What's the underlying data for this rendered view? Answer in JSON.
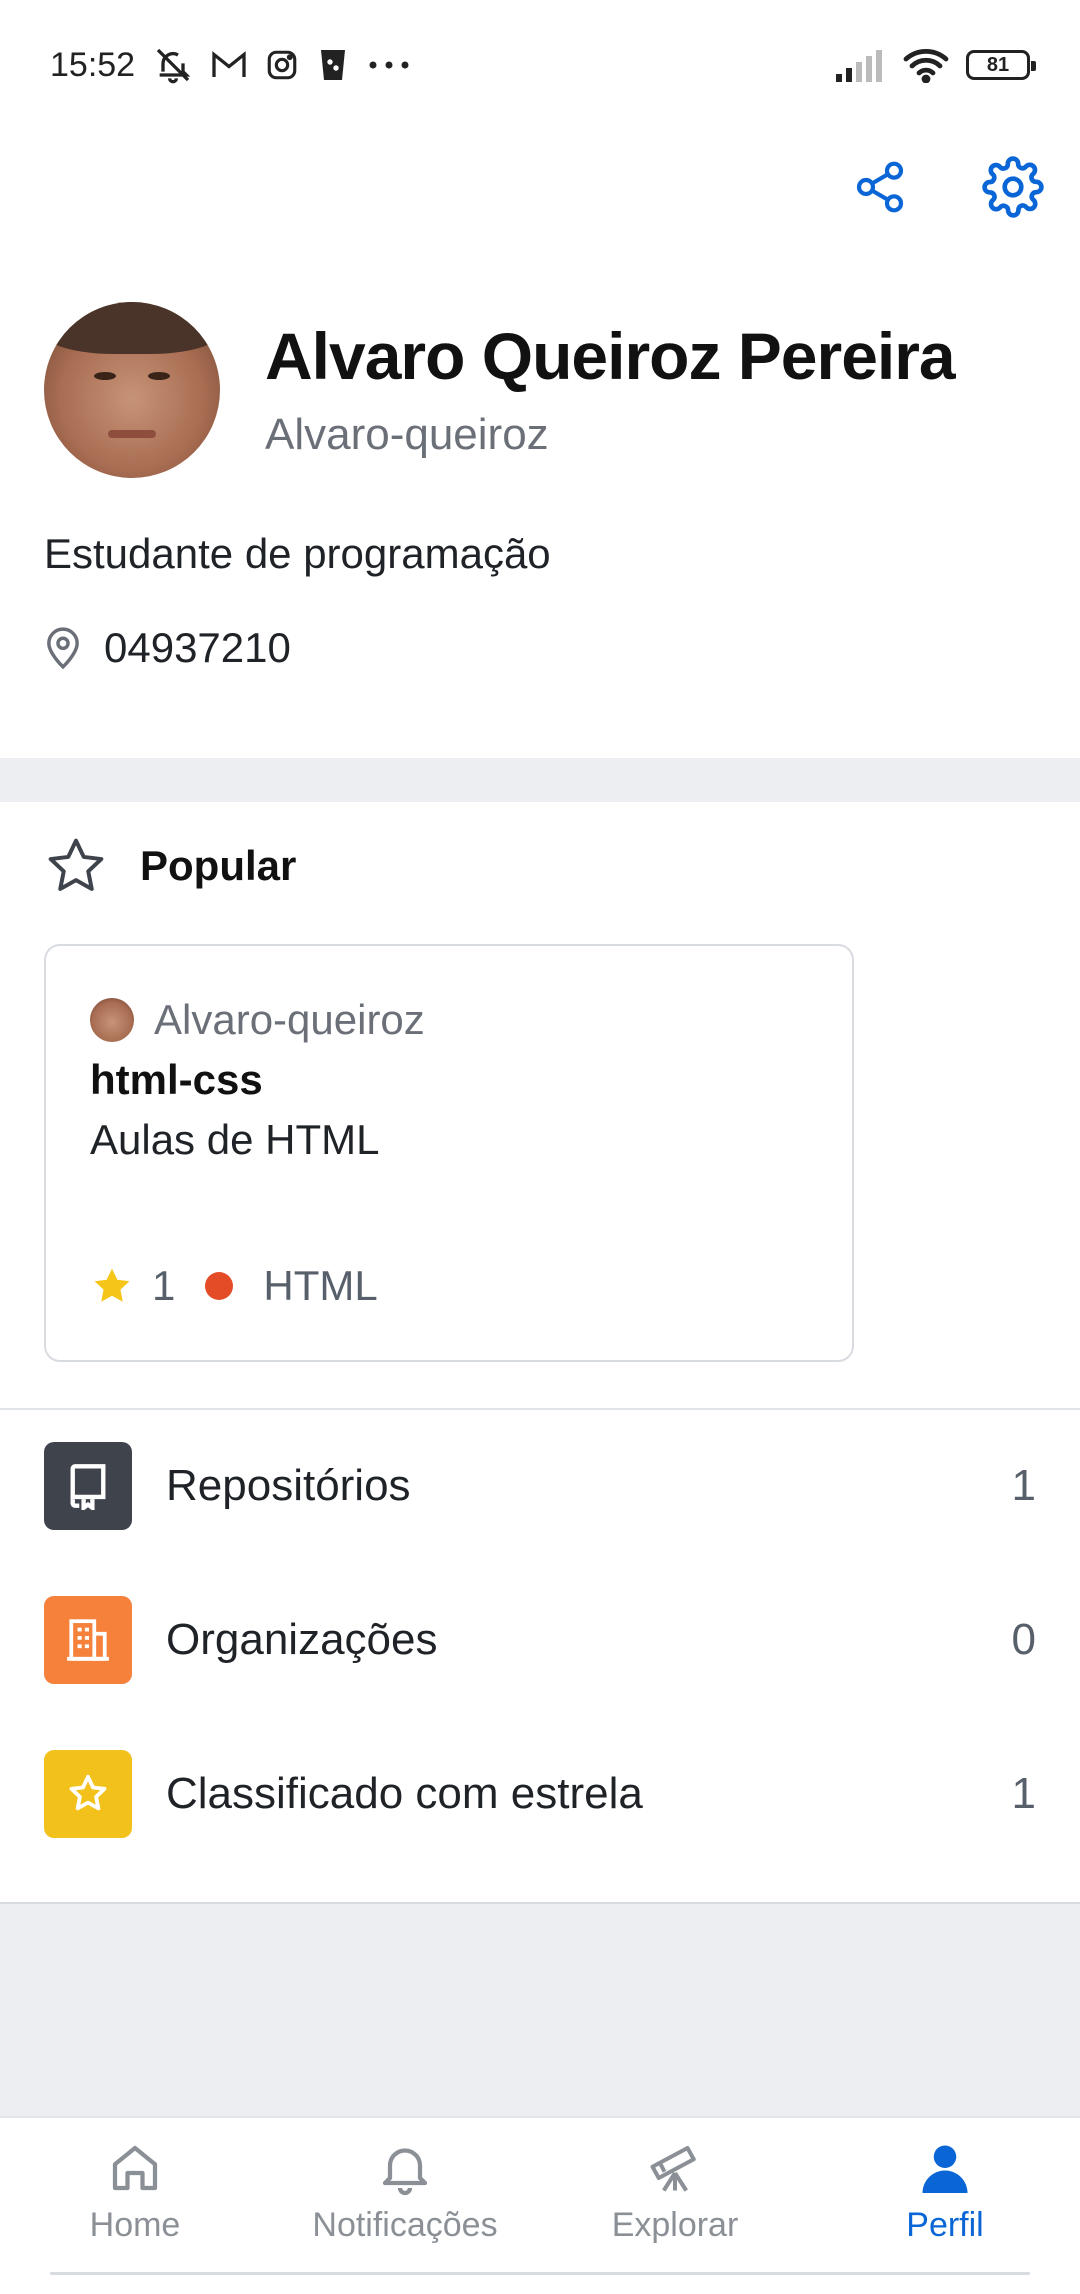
{
  "status_bar": {
    "time": "15:52",
    "battery": "81",
    "icons": [
      "mute-icon",
      "gmail-icon",
      "instagram-icon",
      "cup-icon",
      "more-icon",
      "signal-icon",
      "wifi-icon",
      "battery-icon"
    ]
  },
  "toolbar": {
    "icons": [
      "share-icon",
      "settings-icon"
    ],
    "accent": "#0a66d6"
  },
  "profile": {
    "name": "Alvaro Queiroz Pereira",
    "username": "Alvaro-queiroz",
    "bio": "Estudante de programação",
    "location": "04937210"
  },
  "popular": {
    "title": "Popular",
    "repo": {
      "owner": "Alvaro-queiroz",
      "name": "html-css",
      "description": "Aulas de HTML",
      "stars": "1",
      "language": "HTML",
      "language_color": "#e34c26"
    }
  },
  "menu": {
    "items": [
      {
        "label": "Repositórios",
        "count": "1",
        "icon": "repo-icon",
        "color": "#3f434b"
      },
      {
        "label": "Organizações",
        "count": "0",
        "icon": "organization-icon",
        "color": "#f5813a"
      },
      {
        "label": "Classificado com estrela",
        "count": "1",
        "icon": "star-icon",
        "color": "#f3c11c"
      }
    ]
  },
  "bottom_nav": {
    "items": [
      {
        "label": "Home",
        "icon": "home-icon"
      },
      {
        "label": "Notificações",
        "icon": "bell-icon"
      },
      {
        "label": "Explorar",
        "icon": "telescope-icon"
      },
      {
        "label": "Perfil",
        "icon": "person-icon",
        "active": true
      }
    ]
  }
}
